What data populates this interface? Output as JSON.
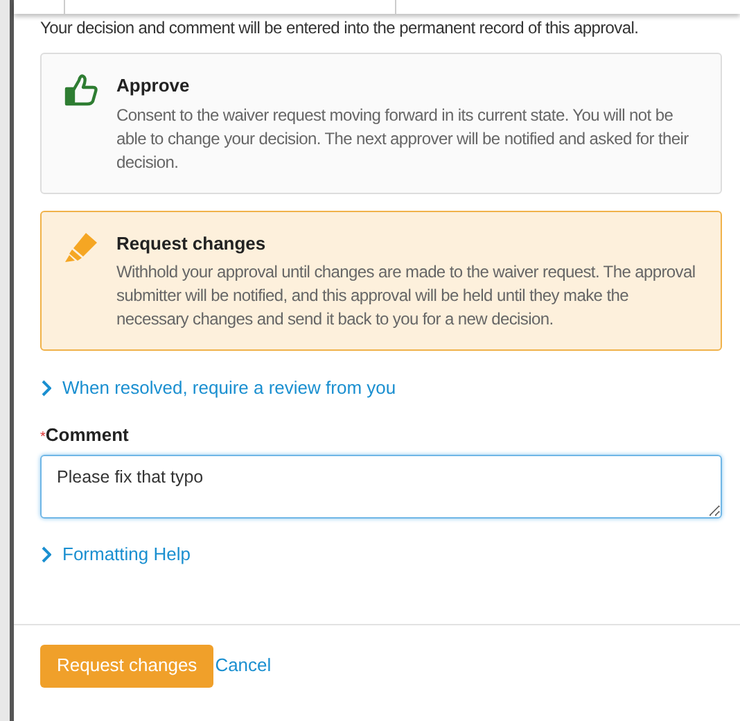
{
  "notice": "Your decision and comment will be entered into the permanent record of this approval.",
  "options": [
    {
      "kind": "approve",
      "title": "Approve",
      "description": "Consent to the waiver request moving forward in its current state. You will not be able to change your decision. The next approver will be notified and asked for their decision.",
      "selected": false
    },
    {
      "kind": "request",
      "title": "Request changes",
      "description": "Withhold your approval until changes are made to the waiver request. The approval submitter will be notified, and this approval will be held until they make the necessary changes and send it back to you for a new decision.",
      "selected": true
    }
  ],
  "review_toggle": {
    "label": "When resolved, require a review from you",
    "expanded": false
  },
  "comment": {
    "label": "Comment",
    "required_mark": "*",
    "value": "Please fix that typo"
  },
  "formatting_help": {
    "label": "Formatting Help",
    "expanded": false
  },
  "buttons": {
    "submit": "Request changes",
    "cancel": "Cancel"
  }
}
